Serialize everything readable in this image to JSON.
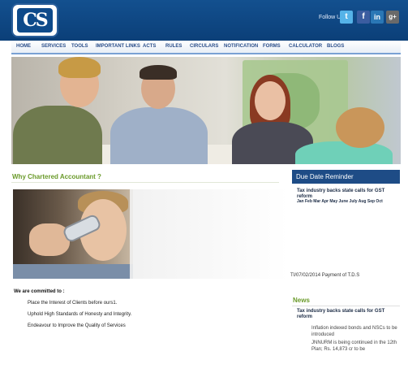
{
  "brand": {
    "logo_text": "CS"
  },
  "social": {
    "label": "Follow Us",
    "icons": [
      {
        "name": "twitter-icon",
        "glyph": "t"
      },
      {
        "name": "facebook-icon",
        "glyph": "f"
      },
      {
        "name": "linkedin-icon",
        "glyph": "in"
      },
      {
        "name": "googleplus-icon",
        "glyph": "g+"
      }
    ]
  },
  "nav": {
    "items": [
      "HOME",
      "SERVICES",
      "TOOLS",
      "IMPORTANT LINKS",
      "ACTS",
      "RULES",
      "CIRCULARS",
      "NOTIFICATION",
      "FORMS",
      "CALCULATOR",
      "BLOGS"
    ]
  },
  "main": {
    "section_title": "Why Chartered Accountant ?",
    "committed_title": "We are committed to :",
    "committed_items": [
      "Place the Interest of Clients before ours1.",
      "Uphold High Standards of Honesty and Integrity.",
      "Endeavour to Improve the Quality of Services"
    ]
  },
  "due_date": {
    "heading": "Due Date Reminder",
    "title": "Tax industry backs state calls for GST reform",
    "months": "Jan Feb Mar Apr May June July Aug Sep Oct",
    "entry": "TI/07/02/2014 Payment of T.D.S"
  },
  "news": {
    "heading": "News",
    "title": "Tax industry backs state calls for GST reform",
    "items": [
      "Inflation indexed bonds and NSCs to be introduced",
      "JNNURM is being continued in the 12th Plan; Rs. 14,873 cr to be"
    ]
  },
  "colors": {
    "header_blue": "#0b3f78",
    "accent_green": "#6a9a2a",
    "due_head_blue": "#1e4c86"
  }
}
